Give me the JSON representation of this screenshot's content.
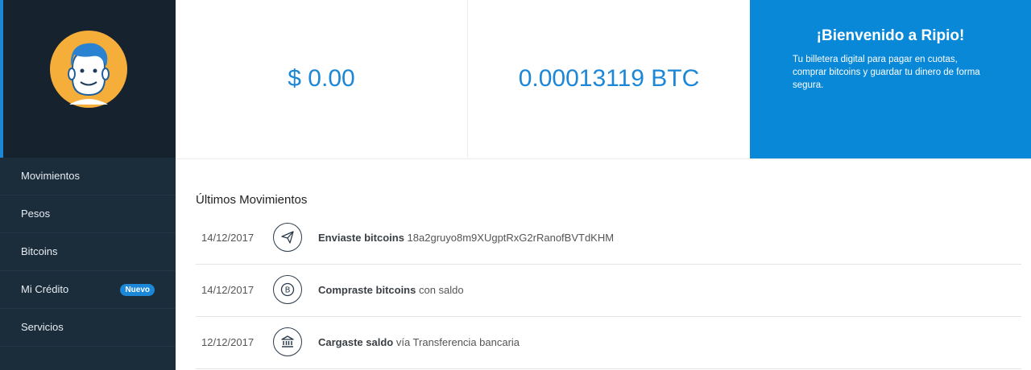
{
  "sidebar": {
    "items": [
      {
        "label": "Movimientos"
      },
      {
        "label": "Pesos"
      },
      {
        "label": "Bitcoins"
      },
      {
        "label": "Mi Crédito",
        "badge": "Nuevo"
      },
      {
        "label": "Servicios"
      }
    ]
  },
  "balances": {
    "ars": "$ 0.00",
    "btc": "0.00013119 BTC"
  },
  "welcome": {
    "title": "¡Bienvenido a Ripio!",
    "text": "Tu billetera digital para pagar en cuotas, comprar bitcoins y guardar tu dinero de forma segura."
  },
  "movements": {
    "title": "Últimos Movimientos",
    "items": [
      {
        "date": "14/12/2017",
        "icon": "send-icon",
        "action": "Enviaste bitcoins",
        "detail": "18a2gruyo8m9XUgptRxG2rRanofBVTdKHM"
      },
      {
        "date": "14/12/2017",
        "icon": "bitcoin-icon",
        "action": "Compraste bitcoins",
        "detail": "con saldo"
      },
      {
        "date": "12/12/2017",
        "icon": "bank-icon",
        "action": "Cargaste saldo",
        "detail": "vía Transferencia bancaria"
      }
    ]
  },
  "colors": {
    "sidebar": "#1b2c3b",
    "accent": "#1b87d6",
    "welcome_bg": "#0a88d8"
  }
}
